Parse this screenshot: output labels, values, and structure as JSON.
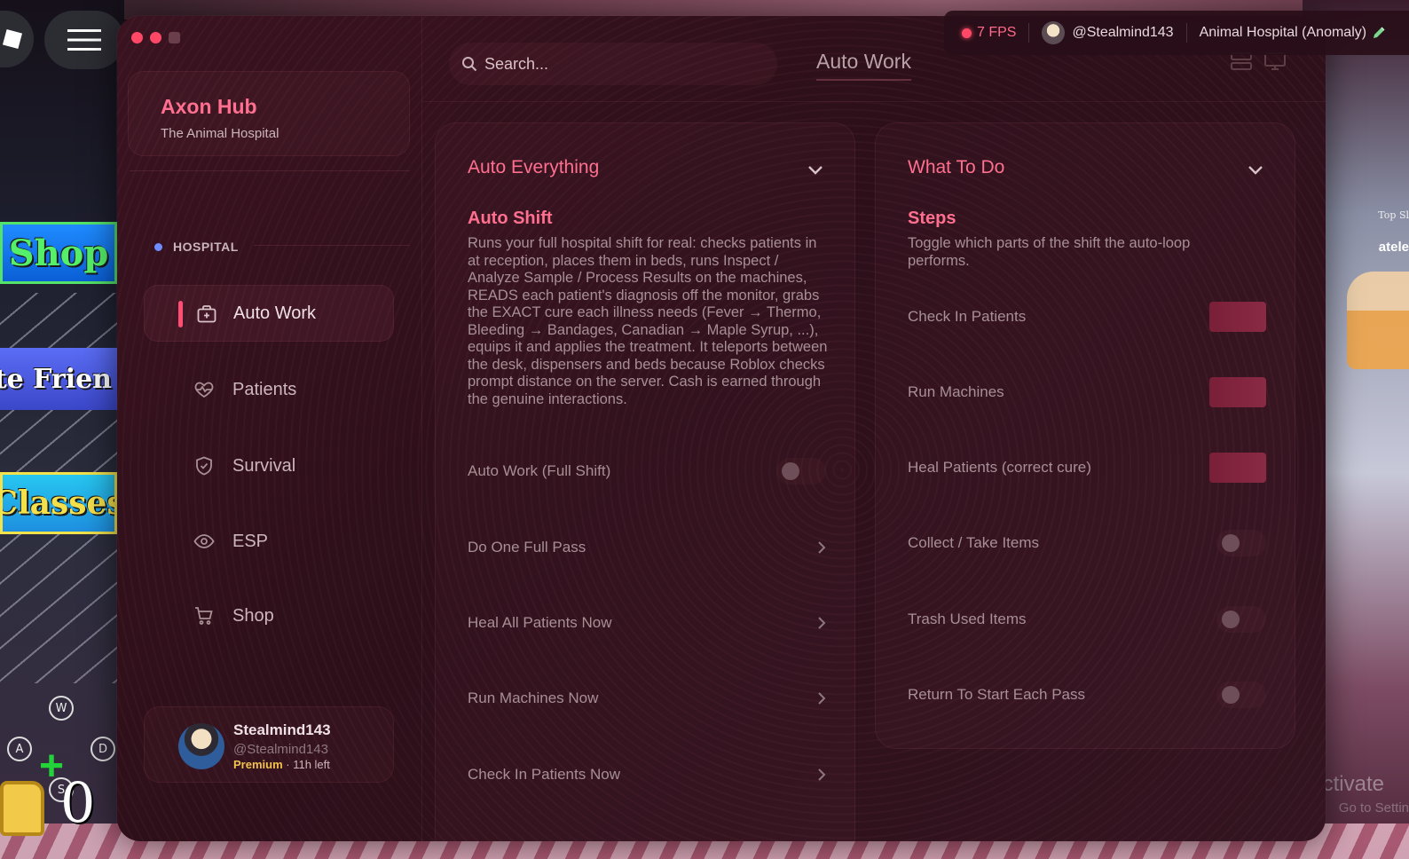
{
  "status_bar": {
    "fps": "7 FPS",
    "username": "@Stealmind143",
    "game": "Animal Hospital (Anomaly)"
  },
  "game_ui": {
    "banners": [
      "Shop",
      "vite Frien",
      "Classes"
    ],
    "keys": [
      "W",
      "A",
      "S",
      "D"
    ],
    "counter": "0",
    "activate_title": "Activate",
    "activate_sub": "Go to Settin",
    "side_text_top": "Top Sl",
    "side_text_name": "atele"
  },
  "brand": {
    "title": "Axon Hub",
    "subtitle": "The Animal Hospital"
  },
  "sidebar": {
    "section": "HOSPITAL",
    "items": [
      {
        "label": "Auto Work",
        "icon": "briefcase-medical-icon",
        "active": true
      },
      {
        "label": "Patients",
        "icon": "heart-pulse-icon",
        "active": false
      },
      {
        "label": "Survival",
        "icon": "shield-check-icon",
        "active": false
      },
      {
        "label": "ESP",
        "icon": "eye-icon",
        "active": false
      },
      {
        "label": "Shop",
        "icon": "cart-icon",
        "active": false
      }
    ]
  },
  "user": {
    "name": "Stealmind143",
    "handle": "@Stealmind143",
    "plan": "Premium",
    "plan_sep": " · ",
    "time_left": "11h left"
  },
  "header": {
    "search_placeholder": "Search...",
    "title": "Auto Work"
  },
  "left_panel": {
    "title": "Auto Everything",
    "subtitle": "Auto Shift",
    "description": "Runs your full hospital shift for real: checks patients in at reception, places them in beds, runs Inspect / Analyze Sample / Process Results on the machines, READS each patient's diagnosis off the monitor, grabs the EXACT cure each illness needs (Fever → Thermo, Bleeding → Bandages, Canadian → Maple Syrup, ...), equips it and applies the treatment. It teleports between the desk, dispensers and beds because Roblox checks prompt distance on the server. Cash is earned through the genuine interactions.",
    "toggle_row": {
      "label": "Auto Work (Full Shift)",
      "on": false
    },
    "action_rows": [
      "Do One Full Pass",
      "Heal All Patients Now",
      "Run Machines Now",
      "Check In Patients Now"
    ]
  },
  "right_panel": {
    "title": "What To Do",
    "subtitle": "Steps",
    "description": "Toggle which parts of the shift the auto-loop performs.",
    "toggles": [
      {
        "label": "Check In Patients",
        "on": true
      },
      {
        "label": "Run Machines",
        "on": true
      },
      {
        "label": "Heal Patients (correct cure)",
        "on": true
      },
      {
        "label": "Collect / Take Items",
        "on": false
      },
      {
        "label": "Trash Used Items",
        "on": false
      },
      {
        "label": "Return To Start Each Pass",
        "on": false
      }
    ]
  },
  "colors": {
    "accent": "#ff6f8f",
    "active_bar": "#ff4d74",
    "window_bg": "#2c0f19",
    "toggle_on": "#7a1f38",
    "premium": "#f2c14e"
  }
}
